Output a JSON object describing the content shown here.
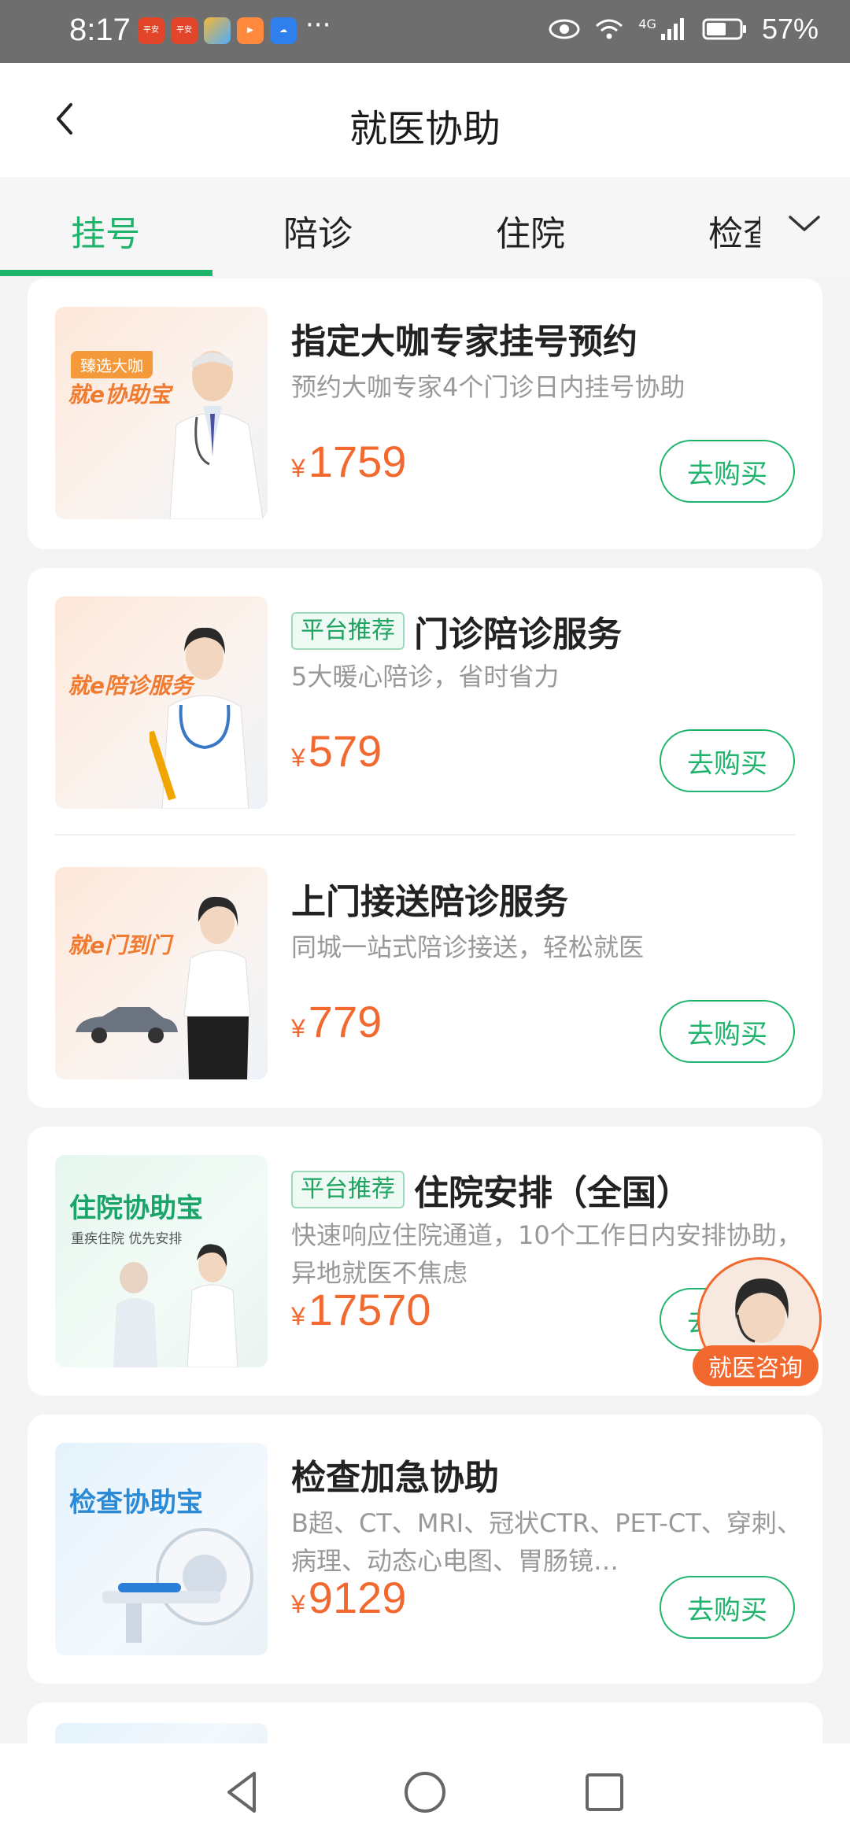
{
  "status_bar": {
    "time": "8:17",
    "battery": "57%",
    "network": "4G",
    "app_icons": [
      {
        "name": "pingan-health-1-icon",
        "label": "平安健康"
      },
      {
        "name": "pingan-health-2-icon",
        "label": "平安健康"
      },
      {
        "name": "color-app-icon",
        "label": ""
      },
      {
        "name": "play-app-icon",
        "label": ""
      },
      {
        "name": "cloud-app-icon",
        "label": ""
      }
    ],
    "more": "···"
  },
  "header": {
    "title": "就医协助"
  },
  "tabs": [
    {
      "label": "挂号",
      "active": true
    },
    {
      "label": "陪诊",
      "active": false
    },
    {
      "label": "住院",
      "active": false
    },
    {
      "label": "检查",
      "active": false
    }
  ],
  "products": [
    {
      "thumb_label": "就e协助宝",
      "thumb_ribbon": "臻选大咖",
      "title": "指定大咖专家挂号预约",
      "badge": "",
      "desc": "预约大咖专家4个门诊日内挂号协助",
      "currency": "¥",
      "price": "1759",
      "buy": "去购买"
    },
    {
      "thumb_label": "就e陪诊服务",
      "title": "门诊陪诊服务",
      "badge": "平台推荐",
      "desc": "5大暖心陪诊，省时省力",
      "currency": "¥",
      "price": "579",
      "buy": "去购买"
    },
    {
      "thumb_label": "就e门到门",
      "title": "上门接送陪诊服务",
      "badge": "",
      "desc": "同城一站式陪诊接送，轻松就医",
      "currency": "¥",
      "price": "779",
      "buy": "去购买"
    },
    {
      "thumb_label": "住院协助宝",
      "thumb_sub": "重疾住院   优先安排",
      "title": "住院安排（全国）",
      "badge": "平台推荐",
      "desc": "快速响应住院通道，10个工作日内安排协助，异地就医不焦虑",
      "currency": "¥",
      "price": "17570",
      "buy": "去购买"
    },
    {
      "thumb_label": "检查协助宝",
      "title": "检查加急协助",
      "badge": "",
      "desc": "B超、CT、MRI、冠状CTR、PET-CT、穿刺、病理、动态心电图、胃肠镜…",
      "currency": "¥",
      "price": "9129",
      "buy": "去购买"
    }
  ],
  "consult": {
    "label": "就医咨询"
  },
  "colors": {
    "accent": "#1fb36b",
    "price": "#f2692f",
    "consult": "#f2692f"
  }
}
